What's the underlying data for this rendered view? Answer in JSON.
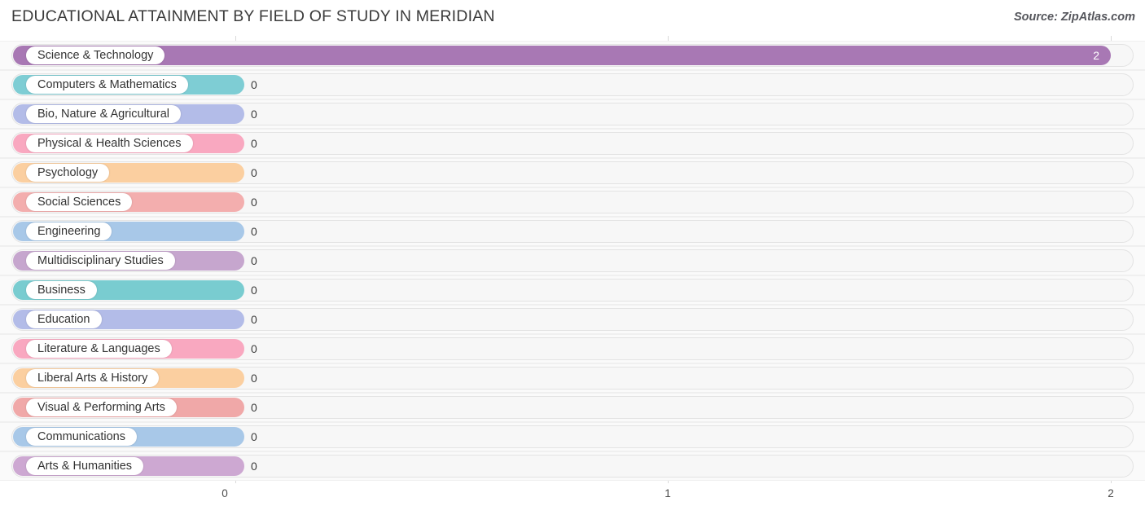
{
  "header": {
    "title": "EDUCATIONAL ATTAINMENT BY FIELD OF STUDY IN MERIDIAN",
    "source": "Source: ZipAtlas.com"
  },
  "chart_data": {
    "type": "bar",
    "orientation": "horizontal",
    "title": "EDUCATIONAL ATTAINMENT BY FIELD OF STUDY IN MERIDIAN",
    "xlabel": "",
    "ylabel": "",
    "xlim": [
      0,
      2
    ],
    "xticks": [
      "0",
      "1",
      "2"
    ],
    "grid": true,
    "legend": "none",
    "categories": [
      "Science & Technology",
      "Computers & Mathematics",
      "Bio, Nature & Agricultural",
      "Physical & Health Sciences",
      "Psychology",
      "Social Sciences",
      "Engineering",
      "Multidisciplinary Studies",
      "Business",
      "Education",
      "Literature & Languages",
      "Liberal Arts & History",
      "Visual & Performing Arts",
      "Communications",
      "Arts & Humanities"
    ],
    "values": [
      2,
      0,
      0,
      0,
      0,
      0,
      0,
      0,
      0,
      0,
      0,
      0,
      0,
      0,
      0
    ],
    "value_labels": [
      "2",
      "0",
      "0",
      "0",
      "0",
      "0",
      "0",
      "0",
      "0",
      "0",
      "0",
      "0",
      "0",
      "0",
      "0"
    ],
    "colors": [
      "#a878b4",
      "#7ecdd4",
      "#b3bce8",
      "#f9a8c0",
      "#fbcfa0",
      "#f3aeae",
      "#a8c8e8",
      "#c6a6ce",
      "#79ccd0",
      "#b3bce8",
      "#f9a8c0",
      "#fbcfa0",
      "#f0a8a8",
      "#a8c8e8",
      "#cda8d2"
    ]
  },
  "axis": {
    "ticks": [
      {
        "label": "0"
      },
      {
        "label": "1"
      },
      {
        "label": "2"
      }
    ]
  }
}
